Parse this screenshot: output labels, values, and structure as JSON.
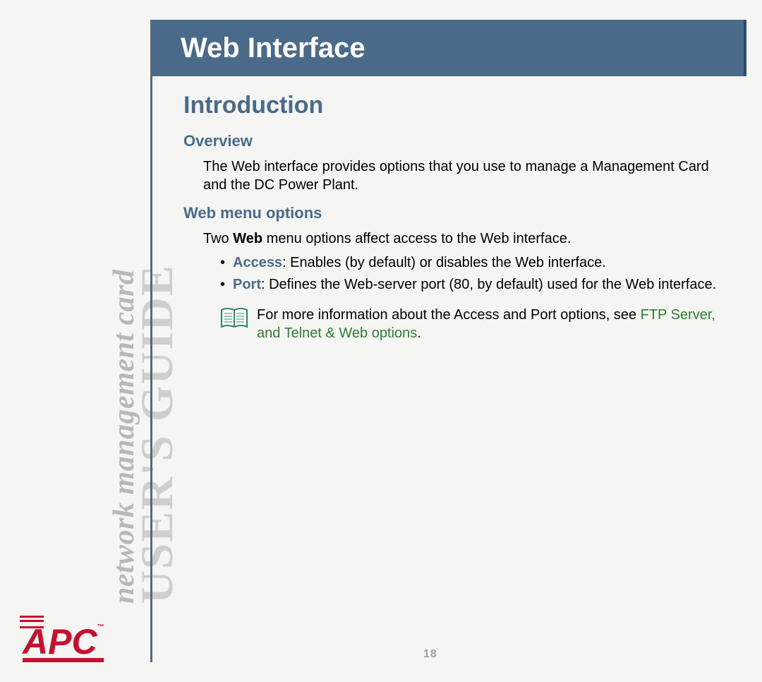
{
  "sidebar": {
    "title": "USER'S GUIDE",
    "subtitle": "network management card"
  },
  "logo": {
    "text": "APC",
    "tm": "™"
  },
  "banner": {
    "title": "Web Interface"
  },
  "section": {
    "h1": "Introduction",
    "overview": {
      "heading": "Overview",
      "text": "The Web interface provides options that you use to manage a Management Card and the DC Power Plant."
    },
    "webmenu": {
      "heading": "Web menu options",
      "intro_pre": "Two ",
      "intro_bold": "Web",
      "intro_post": " menu options affect access to the Web interface.",
      "bullets": [
        {
          "key": "Access",
          "rest": ": Enables (by default) or disables the Web interface."
        },
        {
          "key": "Port",
          "rest": ": Defines the Web-server port (80, by default) used for the Web interface."
        }
      ],
      "note_pre": "For more information about the Access and Port options, see ",
      "note_link": "FTP Server, and Telnet & Web options",
      "note_post": "."
    }
  },
  "page_number": "18"
}
